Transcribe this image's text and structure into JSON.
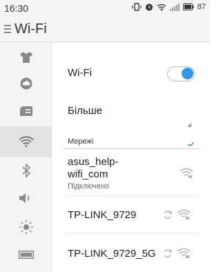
{
  "status_bar": {
    "time": "16:30",
    "battery_level": "87",
    "icons": [
      "vibrate-icon",
      "alarm-icon",
      "wifi-icon",
      "signal-icon",
      "battery-icon"
    ]
  },
  "app_bar": {
    "title": "Wi-Fi",
    "menu_icon": "hamburger-icon"
  },
  "sidebar": {
    "items": [
      {
        "name": "theme",
        "icon": "tshirt-icon",
        "active": false
      },
      {
        "name": "cloud",
        "icon": "cloud-icon",
        "active": false
      },
      {
        "name": "sim",
        "icon": "sim-card-icon",
        "active": false
      },
      {
        "name": "wifi",
        "icon": "wifi-icon",
        "active": true
      },
      {
        "name": "bluetooth",
        "icon": "bluetooth-icon",
        "active": false
      },
      {
        "name": "sound",
        "icon": "speaker-icon",
        "active": false
      },
      {
        "name": "display",
        "icon": "brightness-icon",
        "active": false
      },
      {
        "name": "battery",
        "icon": "battery-icon",
        "active": false
      }
    ]
  },
  "main": {
    "wifi_toggle": {
      "label": "Wi-Fi",
      "enabled": true
    },
    "more": {
      "label": "Більше"
    },
    "networks_header": "Мережі",
    "networks": [
      {
        "name_line1": "asus_help-",
        "name_line2": "wifi_com",
        "status": "Підключено",
        "secured": true,
        "connecting": false
      },
      {
        "name": "TP-LINK_9729",
        "secured": true,
        "connecting": true
      },
      {
        "name": "TP-LINK_9729_5G",
        "secured": true,
        "connecting": true
      }
    ]
  },
  "colors": {
    "accent": "#3595e6",
    "background": "#f4f4f4",
    "active_rail": "#e2e2e2"
  }
}
